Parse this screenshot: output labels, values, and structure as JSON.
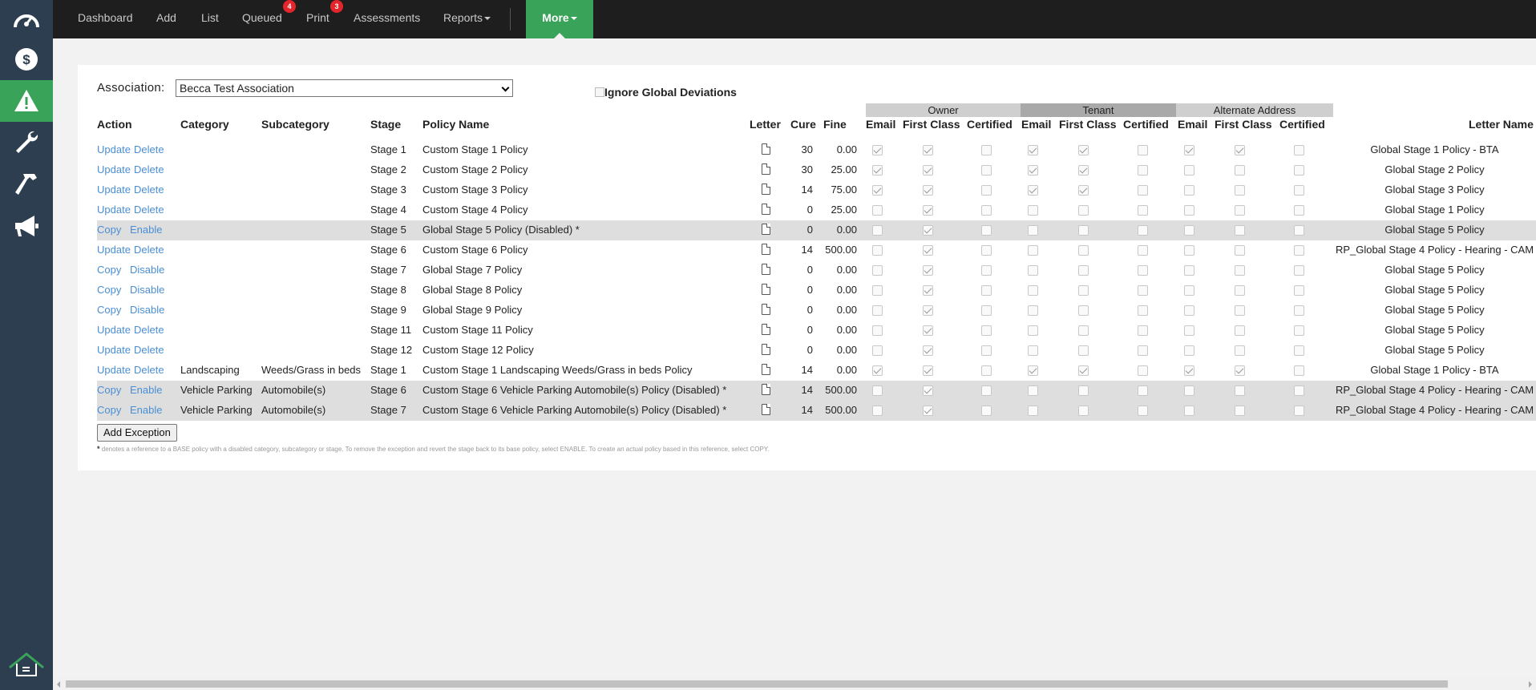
{
  "sidebar": {
    "items": [
      {
        "icon": "dashboard-gauge-icon"
      },
      {
        "icon": "dollar-icon"
      },
      {
        "icon": "warning-icon",
        "active": true
      },
      {
        "icon": "wrench-icon"
      },
      {
        "icon": "hammer-icon"
      },
      {
        "icon": "megaphone-icon"
      }
    ],
    "logo": "home-logo-icon"
  },
  "nav": {
    "dashboard": "Dashboard",
    "add": "Add",
    "list": "List",
    "queued": "Queued",
    "queued_badge": "4",
    "print": "Print",
    "print_badge": "3",
    "assessments": "Assessments",
    "reports": "Reports",
    "more": "More"
  },
  "colors": {
    "sidebar": "#2c3e50",
    "topbar": "#1e1e1e",
    "accent": "#3aa35a",
    "badge": "#e3262b",
    "link": "#4a8fd4"
  },
  "association": {
    "label": "Association:",
    "selected": "Becca Test Association"
  },
  "ignore_global": {
    "label": "Ignore Global Deviations",
    "checked": false
  },
  "groups": {
    "owner": "Owner",
    "tenant": "Tenant",
    "alternate": "Alternate Address"
  },
  "headers": {
    "action": "Action",
    "category": "Category",
    "subcategory": "Subcategory",
    "stage": "Stage",
    "policy_name": "Policy Name",
    "letter": "Letter",
    "cure": "Cure",
    "fine": "Fine",
    "email": "Email",
    "first_class": "First Class",
    "certified": "Certified",
    "letter_name": "Letter Name"
  },
  "rows": [
    {
      "a1": "Update",
      "a2": "Delete",
      "category": "",
      "subcategory": "",
      "stage": "Stage 1",
      "policy": "Custom Stage 1 Policy",
      "cure": "30",
      "fine": "0.00",
      "checks": [
        1,
        1,
        0,
        1,
        1,
        0,
        1,
        1,
        0
      ],
      "letter_name": "Global Stage 1 Policy - BTA",
      "shaded": false
    },
    {
      "a1": "Update",
      "a2": "Delete",
      "category": "",
      "subcategory": "",
      "stage": "Stage 2",
      "policy": "Custom Stage 2 Policy",
      "cure": "30",
      "fine": "25.00",
      "checks": [
        1,
        1,
        0,
        1,
        1,
        0,
        0,
        0,
        0
      ],
      "letter_name": "Global Stage 2 Policy",
      "shaded": false
    },
    {
      "a1": "Update",
      "a2": "Delete",
      "category": "",
      "subcategory": "",
      "stage": "Stage 3",
      "policy": "Custom Stage 3 Policy",
      "cure": "14",
      "fine": "75.00",
      "checks": [
        1,
        1,
        0,
        1,
        1,
        0,
        0,
        0,
        0
      ],
      "letter_name": "Global Stage 3 Policy",
      "shaded": false
    },
    {
      "a1": "Update",
      "a2": "Delete",
      "category": "",
      "subcategory": "",
      "stage": "Stage 4",
      "policy": "Custom Stage 4 Policy",
      "cure": "0",
      "fine": "25.00",
      "checks": [
        0,
        1,
        0,
        0,
        0,
        0,
        0,
        0,
        0
      ],
      "letter_name": "Global Stage 1 Policy",
      "shaded": false
    },
    {
      "a1": "Copy",
      "a2": "Enable",
      "category": "",
      "subcategory": "",
      "stage": "Stage 5",
      "policy": "Global Stage 5 Policy (Disabled) *",
      "cure": "0",
      "fine": "0.00",
      "checks": [
        0,
        1,
        0,
        0,
        0,
        0,
        0,
        0,
        0
      ],
      "letter_name": "Global Stage 5 Policy",
      "shaded": true
    },
    {
      "a1": "Update",
      "a2": "Delete",
      "category": "",
      "subcategory": "",
      "stage": "Stage 6",
      "policy": "Custom Stage 6 Policy",
      "cure": "14",
      "fine": "500.00",
      "checks": [
        0,
        1,
        0,
        0,
        0,
        0,
        0,
        0,
        0
      ],
      "letter_name": "RP_Global Stage 4 Policy - Hearing - CAM",
      "shaded": false
    },
    {
      "a1": "Copy",
      "a2": "Disable",
      "category": "",
      "subcategory": "",
      "stage": "Stage 7",
      "policy": "Global Stage 7 Policy",
      "cure": "0",
      "fine": "0.00",
      "checks": [
        0,
        1,
        0,
        0,
        0,
        0,
        0,
        0,
        0
      ],
      "letter_name": "Global Stage 5 Policy",
      "shaded": false
    },
    {
      "a1": "Copy",
      "a2": "Disable",
      "category": "",
      "subcategory": "",
      "stage": "Stage 8",
      "policy": "Global Stage 8 Policy",
      "cure": "0",
      "fine": "0.00",
      "checks": [
        0,
        1,
        0,
        0,
        0,
        0,
        0,
        0,
        0
      ],
      "letter_name": "Global Stage 5 Policy",
      "shaded": false
    },
    {
      "a1": "Copy",
      "a2": "Disable",
      "category": "",
      "subcategory": "",
      "stage": "Stage 9",
      "policy": "Global Stage 9 Policy",
      "cure": "0",
      "fine": "0.00",
      "checks": [
        0,
        1,
        0,
        0,
        0,
        0,
        0,
        0,
        0
      ],
      "letter_name": "Global Stage 5 Policy",
      "shaded": false
    },
    {
      "a1": "Update",
      "a2": "Delete",
      "category": "",
      "subcategory": "",
      "stage": "Stage 11",
      "policy": "Custom Stage 11 Policy",
      "cure": "0",
      "fine": "0.00",
      "checks": [
        0,
        1,
        0,
        0,
        0,
        0,
        0,
        0,
        0
      ],
      "letter_name": "Global Stage 5 Policy",
      "shaded": false
    },
    {
      "a1": "Update",
      "a2": "Delete",
      "category": "",
      "subcategory": "",
      "stage": "Stage 12",
      "policy": "Custom Stage 12 Policy",
      "cure": "0",
      "fine": "0.00",
      "checks": [
        0,
        1,
        0,
        0,
        0,
        0,
        0,
        0,
        0
      ],
      "letter_name": "Global Stage 5 Policy",
      "shaded": false
    },
    {
      "a1": "Update",
      "a2": "Delete",
      "category": "Landscaping",
      "subcategory": "Weeds/Grass in beds",
      "stage": "Stage 1",
      "policy": "Custom Stage 1 Landscaping Weeds/Grass in beds Policy",
      "cure": "14",
      "fine": "0.00",
      "checks": [
        1,
        1,
        0,
        1,
        1,
        0,
        1,
        1,
        0
      ],
      "letter_name": "Global Stage 1 Policy - BTA",
      "shaded": false
    },
    {
      "a1": "Copy",
      "a2": "Enable",
      "category": "Vehicle Parking",
      "subcategory": "Automobile(s)",
      "stage": "Stage 6",
      "policy": "Custom Stage 6 Vehicle Parking Automobile(s) Policy (Disabled) *",
      "cure": "14",
      "fine": "500.00",
      "checks": [
        0,
        1,
        0,
        0,
        0,
        0,
        0,
        0,
        0
      ],
      "letter_name": "RP_Global Stage 4 Policy - Hearing - CAM",
      "shaded": true
    },
    {
      "a1": "Copy",
      "a2": "Enable",
      "category": "Vehicle Parking",
      "subcategory": "Automobile(s)",
      "stage": "Stage 7",
      "policy": "Custom Stage 6 Vehicle Parking Automobile(s) Policy (Disabled) *",
      "cure": "14",
      "fine": "500.00",
      "checks": [
        0,
        1,
        0,
        0,
        0,
        0,
        0,
        0,
        0
      ],
      "letter_name": "RP_Global Stage 4 Policy - Hearing - CAM",
      "shaded": true
    }
  ],
  "add_exception": "Add Exception",
  "footnote": {
    "star": "*",
    "text": " denotes a reference to a BASE policy with a disabled category, subcategory or stage. To remove the exception and revert the stage back to its base policy, select ENABLE. To create an actual policy based in this reference, select COPY."
  }
}
